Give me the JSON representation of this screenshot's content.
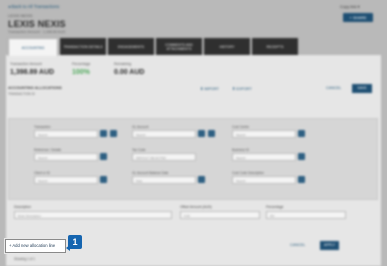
{
  "header": {
    "back_link": "◂ Back to All Transactions",
    "top_right": "Copy link ▾",
    "share_label": "+ SHARE",
    "company_small": "LEXIS NEXIS",
    "company_name": "LEXIS NEXIS",
    "company_sub": "Transaction Amount · 1,398.89 AUD"
  },
  "tabs": [
    {
      "label": "ACCOUNTING",
      "active": true
    },
    {
      "label": "TRANSACTION DETAILS",
      "active": false
    },
    {
      "label": "ENGAGEMENTS",
      "active": false
    },
    {
      "label": "COMMENTS AND ATTACHMENTS",
      "active": false
    },
    {
      "label": "HISTORY",
      "active": false
    },
    {
      "label": "RECEIPTS",
      "active": false
    }
  ],
  "amounts": {
    "transaction_label": "Transaction Amount",
    "transaction_value": "1,398.89 AUD",
    "percentage_label": "Percentage",
    "percentage_value": "100%",
    "remaining_label": "Remaining",
    "remaining_value": "0.00 AUD"
  },
  "section": {
    "title": "ACCOUNTING ALLOCATIONS",
    "subtitle": "TRANSACTION ID",
    "import_label": "⬇ IMPORT",
    "export_label": "⬆ EXPORT",
    "cancel_label": "CANCEL",
    "save_label": "SAVE"
  },
  "form": {
    "fields": [
      {
        "label": "Transaction",
        "placeholder": "Search"
      },
      {
        "label": "GL Account",
        "placeholder": "Search"
      },
      {
        "label": "Cost Centre",
        "placeholder": "Search"
      },
      {
        "label": "Reference / Details",
        "placeholder": "Search"
      },
      {
        "label": "Tax Code",
        "placeholder": "DEFAULT SELECTED"
      },
      {
        "label": "Business ID",
        "placeholder": "Search"
      },
      {
        "label": "Client or ID",
        "placeholder": "Search"
      },
      {
        "label": "GL Account Balance Date",
        "placeholder": "Date"
      },
      {
        "label": "Cost Code Description",
        "placeholder": "Search"
      }
    ],
    "description_label": "Description",
    "description_placeholder": "Enter Description",
    "offset_label": "Offset Amount (AUD)",
    "offset_value": "0.00",
    "percentage_label": "Percentage",
    "percentage_value": "0%"
  },
  "footer": {
    "add_line_label": "+ Add new allocation line",
    "cancel_label": "CANCEL",
    "apply_label": "APPLY",
    "footnote": "Showing 1 of 1"
  },
  "step_badge": "1",
  "colors": {
    "accent": "#1e4f73",
    "badge": "#1565b0",
    "percent_green": "#4ea85a"
  }
}
